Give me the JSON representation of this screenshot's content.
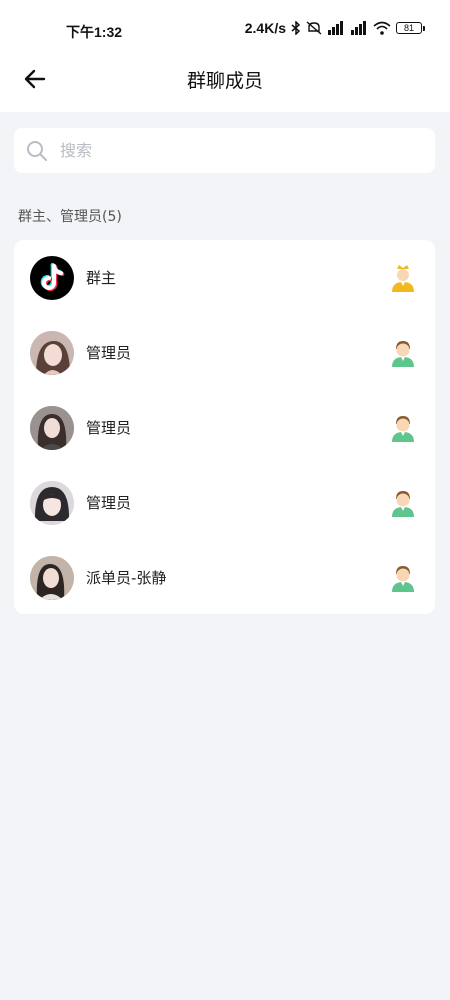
{
  "status_bar": {
    "time": "下午1:32",
    "speed": "2.4K/s",
    "battery": "81"
  },
  "header": {
    "title": "群聊成员"
  },
  "search": {
    "placeholder": "搜索"
  },
  "section": {
    "label": "群主、管理员(5)"
  },
  "members": [
    {
      "name": "群主",
      "avatar": "tiktok-logo-avatar",
      "role_icon": "owner-crown-icon",
      "role_color": "#f3b81d"
    },
    {
      "name": "管理员",
      "avatar": "user-photo-avatar",
      "role_icon": "admin-person-icon",
      "role_color": "#5ec58d"
    },
    {
      "name": "管理员",
      "avatar": "user-photo-avatar",
      "role_icon": "admin-person-icon",
      "role_color": "#5ec58d"
    },
    {
      "name": "管理员",
      "avatar": "user-photo-avatar",
      "role_icon": "admin-person-icon",
      "role_color": "#5ec58d"
    },
    {
      "name": "派单员-张静",
      "avatar": "user-photo-avatar",
      "role_icon": "admin-person-icon",
      "role_color": "#5ec58d"
    }
  ],
  "colors": {
    "background": "#f3f4f8",
    "card": "#ffffff",
    "placeholder": "#b9bcc4"
  }
}
